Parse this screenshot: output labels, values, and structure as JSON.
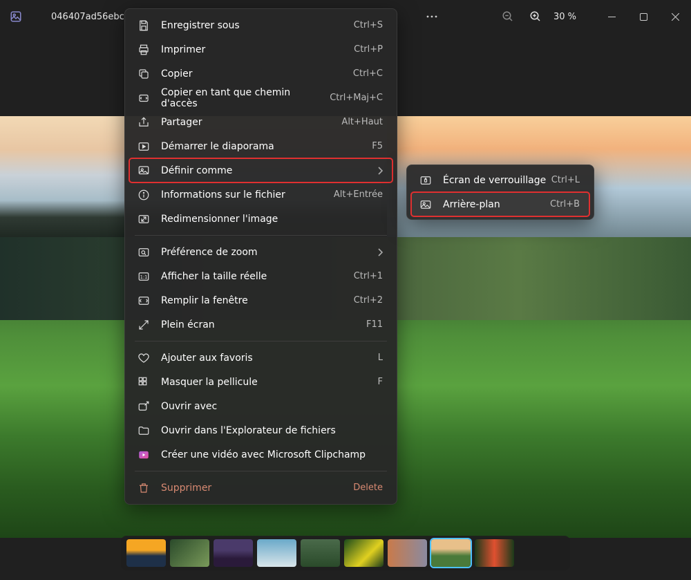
{
  "titlebar": {
    "filename": "046407ad56ebc",
    "zoom": "30 %"
  },
  "menu": {
    "save_as": {
      "label": "Enregistrer sous",
      "shortcut": "Ctrl+S"
    },
    "print": {
      "label": "Imprimer",
      "shortcut": "Ctrl+P"
    },
    "copy": {
      "label": "Copier",
      "shortcut": "Ctrl+C"
    },
    "copy_path": {
      "label": "Copier en tant que chemin d'accès",
      "shortcut": "Ctrl+Maj+C"
    },
    "share": {
      "label": "Partager",
      "shortcut": "Alt+Haut"
    },
    "slideshow": {
      "label": "Démarrer le diaporama",
      "shortcut": "F5"
    },
    "set_as": {
      "label": "Définir comme"
    },
    "file_info": {
      "label": "Informations sur le fichier",
      "shortcut": "Alt+Entrée"
    },
    "resize": {
      "label": "Redimensionner l'image"
    },
    "zoom_pref": {
      "label": "Préférence de zoom"
    },
    "actual_size": {
      "label": "Afficher la taille réelle",
      "shortcut": "Ctrl+1"
    },
    "fill_window": {
      "label": "Remplir la fenêtre",
      "shortcut": "Ctrl+2"
    },
    "fullscreen": {
      "label": "Plein écran",
      "shortcut": "F11"
    },
    "favorite": {
      "label": "Ajouter aux favoris",
      "shortcut": "L"
    },
    "hide_film": {
      "label": "Masquer la pellicule",
      "shortcut": "F"
    },
    "open_with": {
      "label": "Ouvrir avec"
    },
    "open_explorer": {
      "label": "Ouvrir dans l'Explorateur de fichiers"
    },
    "clipchamp": {
      "label": "Créer une vidéo avec Microsoft Clipchamp"
    },
    "delete": {
      "label": "Supprimer",
      "shortcut": "Delete"
    }
  },
  "submenu": {
    "lockscreen": {
      "label": "Écran de verrouillage",
      "shortcut": "Ctrl+L"
    },
    "background": {
      "label": "Arrière-plan",
      "shortcut": "Ctrl+B"
    }
  },
  "thumbnails": [
    {
      "bg": "linear-gradient(to bottom,#f5a623 40%,#1e3048 60%)"
    },
    {
      "bg": "linear-gradient(135deg,#2a4a2a,#7a9a5a)"
    },
    {
      "bg": "linear-gradient(to bottom,#4a3a6a 40%,#2a1a3a 70%)"
    },
    {
      "bg": "linear-gradient(to bottom,#6aa9c9,#d9e5ea)"
    },
    {
      "bg": "linear-gradient(to bottom,#4a6a4a,#2a4a2a)"
    },
    {
      "bg": "linear-gradient(135deg,#1a4a1a,#e0d020 60%,#1a3a1a)"
    },
    {
      "bg": "linear-gradient(to right,#c97a4a,#8a8aa0)"
    },
    {
      "bg": "linear-gradient(to bottom,#e8c08a 35%,#4a7a3a 60%)"
    },
    {
      "bg": "linear-gradient(to right,#1a3a1a,#e05030 50%,#1a3a1a)"
    }
  ],
  "selected_thumb": 7
}
